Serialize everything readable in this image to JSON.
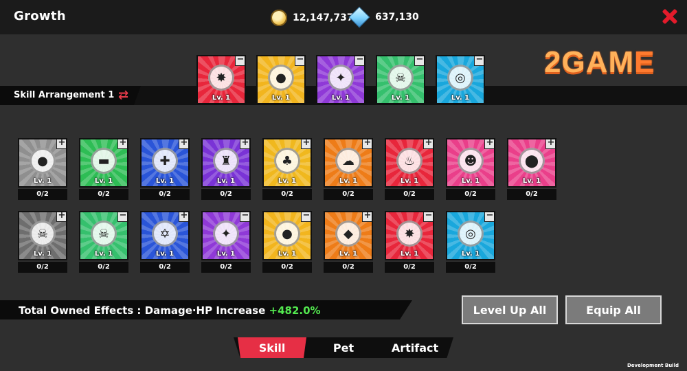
{
  "header": {
    "title": "Growth",
    "gold": "12,147,737",
    "gems": "637,130"
  },
  "arrangement": {
    "label": "Skill Arrangement 1"
  },
  "logo": {
    "text_a": "2GAM",
    "text_b": "E"
  },
  "equipped": [
    {
      "name": "slot-1",
      "level": "Lv. 1",
      "color": "#e8263b",
      "glyph": "✸"
    },
    {
      "name": "slot-2",
      "level": "Lv. 1",
      "color": "#f2b51e",
      "glyph": "●"
    },
    {
      "name": "slot-3",
      "level": "Lv. 1",
      "color": "#8f39d7",
      "glyph": "✦"
    },
    {
      "name": "slot-4",
      "level": "Lv. 1",
      "color": "#35c06d",
      "glyph": "☠"
    },
    {
      "name": "slot-5",
      "level": "Lv. 1",
      "color": "#19a7dc",
      "glyph": "◎"
    }
  ],
  "skills": [
    {
      "level": "Lv. 1",
      "count": "0/2",
      "color": "#8f8f8f",
      "glyph": "●",
      "btn": "+"
    },
    {
      "level": "Lv. 1",
      "count": "0/2",
      "color": "#2ebd55",
      "glyph": "▬",
      "btn": "+"
    },
    {
      "level": "Lv. 1",
      "count": "0/2",
      "color": "#2a55d8",
      "glyph": "✚",
      "btn": "+"
    },
    {
      "level": "Lv. 1",
      "count": "0/2",
      "color": "#7a33d6",
      "glyph": "♜",
      "btn": "+"
    },
    {
      "level": "Lv. 1",
      "count": "0/2",
      "color": "#f0b81e",
      "glyph": "♣",
      "btn": "+"
    },
    {
      "level": "Lv. 1",
      "count": "0/2",
      "color": "#ee7c18",
      "glyph": "☁",
      "btn": "+"
    },
    {
      "level": "Lv. 1",
      "count": "0/2",
      "color": "#e8263b",
      "glyph": "♨",
      "btn": "+"
    },
    {
      "level": "Lv. 1",
      "count": "0/2",
      "color": "#ea3f8a",
      "glyph": "☻",
      "btn": "+"
    },
    {
      "level": "Lv. 1",
      "count": "0/2",
      "color": "#ea3f8a",
      "glyph": "⬤",
      "btn": "+"
    },
    {
      "level": "Lv. 1",
      "count": "0/2",
      "color": "#6e6e6e",
      "glyph": "☠",
      "btn": "+"
    },
    {
      "level": "Lv. 1",
      "count": "0/2",
      "color": "#35c06d",
      "glyph": "☠",
      "btn": "−"
    },
    {
      "level": "Lv. 1",
      "count": "0/2",
      "color": "#2a55d8",
      "glyph": "✡",
      "btn": "+"
    },
    {
      "level": "Lv. 1",
      "count": "0/2",
      "color": "#8f39d7",
      "glyph": "✦",
      "btn": "−"
    },
    {
      "level": "Lv. 1",
      "count": "0/2",
      "color": "#f2b51e",
      "glyph": "●",
      "btn": "−"
    },
    {
      "level": "Lv. 1",
      "count": "0/2",
      "color": "#ee7c18",
      "glyph": "◆",
      "btn": "+"
    },
    {
      "level": "Lv. 1",
      "count": "0/2",
      "color": "#e8263b",
      "glyph": "✸",
      "btn": "−"
    },
    {
      "level": "Lv. 1",
      "count": "0/2",
      "color": "#19a7dc",
      "glyph": "◎",
      "btn": "−"
    }
  ],
  "effects": {
    "label": "Total Owned Effects : Damage·HP Increase",
    "value": "+482.0%"
  },
  "buttons": {
    "level_up_all": "Level Up All",
    "equip_all": "Equip All"
  },
  "tabs": {
    "skill": "Skill",
    "pet": "Pet",
    "artifact": "Artifact"
  },
  "footer": {
    "build": "Development Build"
  },
  "colors": {
    "accent": "#e62f45",
    "positive": "#53e84f"
  }
}
